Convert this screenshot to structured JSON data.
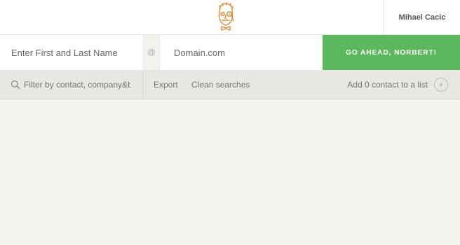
{
  "header": {
    "user_name": "Mihael Cacic",
    "logo_icon": "norbert-mascot-icon"
  },
  "search": {
    "name_placeholder": "Enter First and Last Name",
    "at_symbol": "@",
    "domain_placeholder": "Domain.com",
    "go_button_label": "GO AHEAD, NORBERT!"
  },
  "toolbar": {
    "filter_placeholder": "Filter by contact, company&b",
    "export_label": "Export",
    "clean_label": "Clean searches",
    "add_list_label": "Add 0 contact to a list",
    "plus_symbol": "+"
  },
  "colors": {
    "accent_green": "#5cb85c",
    "logo_orange": "#d98a3c",
    "background": "#f5f4f1",
    "toolbar_bg": "#e9e7e3"
  }
}
